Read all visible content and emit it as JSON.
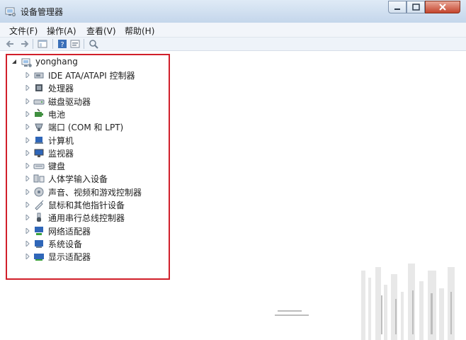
{
  "window": {
    "title": "设备管理器"
  },
  "menu": [
    "文件(F)",
    "操作(A)",
    "查看(V)",
    "帮助(H)"
  ],
  "toolbar": {
    "icons": [
      "back-arrow-icon",
      "forward-arrow-icon",
      "show-hide-console-tree-icon",
      "help-icon",
      "properties-icon",
      "scan-hardware-icon"
    ]
  },
  "tree": {
    "root": "yonghang",
    "items": [
      {
        "label": "IDE ATA/ATAPI 控制器",
        "icon": "ide-controller-icon"
      },
      {
        "label": "处理器",
        "icon": "processor-icon"
      },
      {
        "label": "磁盘驱动器",
        "icon": "disk-drive-icon"
      },
      {
        "label": "电池",
        "icon": "battery-icon"
      },
      {
        "label": "端口 (COM 和 LPT)",
        "icon": "port-icon"
      },
      {
        "label": "计算机",
        "icon": "computer-icon"
      },
      {
        "label": "监视器",
        "icon": "monitor-icon"
      },
      {
        "label": "键盘",
        "icon": "keyboard-icon"
      },
      {
        "label": "人体学输入设备",
        "icon": "hid-icon"
      },
      {
        "label": "声音、视频和游戏控制器",
        "icon": "sound-controller-icon"
      },
      {
        "label": "鼠标和其他指针设备",
        "icon": "mouse-icon"
      },
      {
        "label": "通用串行总线控制器",
        "icon": "usb-controller-icon"
      },
      {
        "label": "网络适配器",
        "icon": "network-adapter-icon"
      },
      {
        "label": "系统设备",
        "icon": "system-device-icon"
      },
      {
        "label": "显示适配器",
        "icon": "display-adapter-icon"
      }
    ]
  },
  "colors": {
    "highlight_border": "#d11f2a",
    "titlebar": "#c4d6eb"
  }
}
